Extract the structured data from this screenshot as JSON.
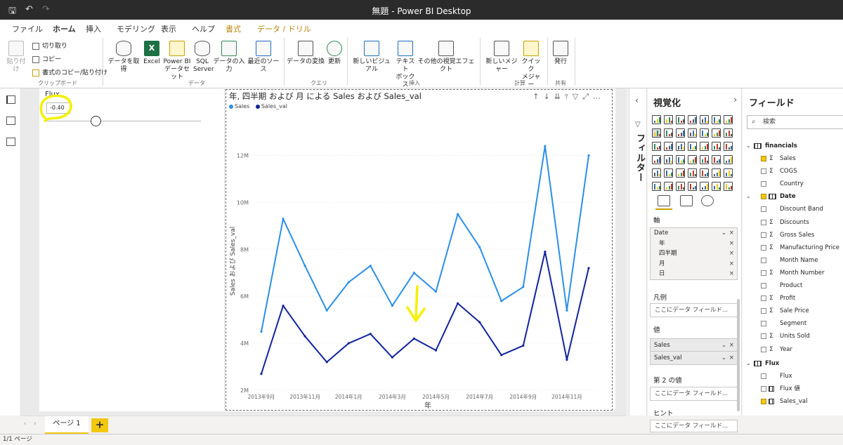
{
  "window": {
    "title": "無題 - Power BI Desktop"
  },
  "ribbon": {
    "tabs": [
      {
        "label": "ファイル",
        "active": false
      },
      {
        "label": "ホーム",
        "active": true
      },
      {
        "label": "挿入",
        "active": false
      },
      {
        "label": "モデリング",
        "active": false
      },
      {
        "label": "表示",
        "active": false
      },
      {
        "label": "ヘルプ",
        "active": false
      },
      {
        "label": "書式",
        "active": false,
        "contextual": true
      },
      {
        "label": "データ / ドリル",
        "active": false,
        "contextual": true
      }
    ],
    "clipboard": {
      "paste": "貼り付け",
      "cut": "切り取り",
      "copy": "コピー",
      "format_painter": "書式のコピー/貼り付け",
      "group": "クリップボード"
    },
    "data": {
      "get_data": "データを取得",
      "excel": "Excel",
      "pbi_dataset_1": "Power BI",
      "pbi_dataset_2": "データセット",
      "sql_1": "SQL",
      "sql_2": "Server",
      "enter_data": "データの入力",
      "recent_sources": "最近のソース",
      "group": "データ"
    },
    "query": {
      "transform": "データの変換",
      "refresh": "更新",
      "group": "クエリ"
    },
    "insert": {
      "new_visual": "新しいビジュアル",
      "textbox_1": "テキスト",
      "textbox_2": "ボックス",
      "more_visuals": "その他の視覚エフェクト",
      "group": "挿入"
    },
    "calc": {
      "new_measure": "新しいメジャー",
      "quick_measure_1": "クイック",
      "quick_measure_2": "メジャー",
      "group": "計算"
    },
    "share": {
      "publish": "発行",
      "group": "共有"
    }
  },
  "slicer": {
    "title": "Flux",
    "value": "-0.40"
  },
  "chart": {
    "title": "年, 四半期 および 月 による Sales および Sales_val",
    "legend": [
      "Sales",
      "Sales_val"
    ],
    "ylabel": "Sales および Sales_val",
    "xlabel": "年"
  },
  "chart_data": {
    "type": "line",
    "title": "年, 四半期 および 月 による Sales および Sales_val",
    "xlabel": "年",
    "ylabel": "Sales および Sales_val",
    "x": [
      "2013年9月",
      "2013年10月",
      "2013年11月",
      "2013年12月",
      "2014年1月",
      "2014年2月",
      "2014年3月",
      "2014年4月",
      "2014年5月",
      "2014年6月",
      "2014年7月",
      "2014年8月",
      "2014年9月",
      "2014年10月",
      "2014年11月",
      "2014年12月"
    ],
    "x_tick_labels": [
      "2013年9月",
      "2013年11月",
      "2014年1月",
      "2014年3月",
      "2014年5月",
      "2014年7月",
      "2014年9月",
      "2014年11月"
    ],
    "y_ticks": [
      "2M",
      "4M",
      "6M",
      "8M",
      "10M",
      "12M"
    ],
    "ylim": [
      2,
      13
    ],
    "y_unit": "M",
    "legend_position": "top-left",
    "grid": true,
    "series": [
      {
        "name": "Sales",
        "color": "#2b8fe9",
        "values": [
          4.5,
          9.3,
          7.3,
          5.4,
          6.6,
          7.3,
          5.6,
          7.0,
          6.2,
          9.5,
          8.1,
          5.8,
          6.4,
          12.4,
          5.4,
          12.0
        ]
      },
      {
        "name": "Sales_val",
        "color": "#12239e",
        "values": [
          2.7,
          5.6,
          4.3,
          3.2,
          4.0,
          4.4,
          3.4,
          4.2,
          3.7,
          5.7,
          4.9,
          3.5,
          3.9,
          7.9,
          3.3,
          7.2
        ]
      }
    ]
  },
  "filters_pane": {
    "label": "フィルター"
  },
  "viz_pane": {
    "title": "視覚化",
    "axis_label": "軸",
    "axis_field": "Date",
    "axis_items": [
      "年",
      "四半期",
      "月",
      "日"
    ],
    "legend_label": "凡例",
    "legend_placeholder": "ここにデータ フィールド...",
    "values_label": "値",
    "values": [
      "Sales",
      "Sales_val"
    ],
    "secondary_values_label": "第 2 の値",
    "secondary_placeholder": "ここにデータ フィールド...",
    "tooltips_label": "ヒント",
    "tooltips_placeholder": "ここにデータ フィールド..."
  },
  "fields_pane": {
    "title": "フィールド",
    "search_placeholder": "検索",
    "tables": [
      {
        "name": "financials",
        "fields": [
          {
            "name": "Sales",
            "sigma": true,
            "checked": true
          },
          {
            "name": "COGS",
            "sigma": true,
            "checked": false
          },
          {
            "name": "Country",
            "sigma": false,
            "checked": false
          },
          {
            "name": "Date",
            "sigma": false,
            "checked": true,
            "hierarchy": true
          },
          {
            "name": "Discount Band",
            "sigma": false,
            "checked": false
          },
          {
            "name": "Discounts",
            "sigma": true,
            "checked": false
          },
          {
            "name": "Gross Sales",
            "sigma": true,
            "checked": false
          },
          {
            "name": "Manufacturing Price",
            "sigma": true,
            "checked": false
          },
          {
            "name": "Month Name",
            "sigma": false,
            "checked": false
          },
          {
            "name": "Month Number",
            "sigma": true,
            "checked": false
          },
          {
            "name": "Product",
            "sigma": false,
            "checked": false
          },
          {
            "name": "Profit",
            "sigma": true,
            "checked": false
          },
          {
            "name": "Sale Price",
            "sigma": true,
            "checked": false
          },
          {
            "name": "Segment",
            "sigma": false,
            "checked": false
          },
          {
            "name": "Units Sold",
            "sigma": true,
            "checked": false
          },
          {
            "name": "Year",
            "sigma": true,
            "checked": false
          }
        ]
      },
      {
        "name": "Flux",
        "fields": [
          {
            "name": "Flux",
            "sigma": false,
            "checked": false
          },
          {
            "name": "Flux 値",
            "sigma": false,
            "checked": false,
            "measure": true
          },
          {
            "name": "Sales_val",
            "sigma": false,
            "checked": true,
            "measure": true
          }
        ]
      }
    ]
  },
  "pages": {
    "tab": "ページ 1",
    "add": "+"
  },
  "status": {
    "text": "1/1 ページ"
  },
  "colors": {
    "accent": "#f2c811",
    "annotation": "#f5f000"
  }
}
